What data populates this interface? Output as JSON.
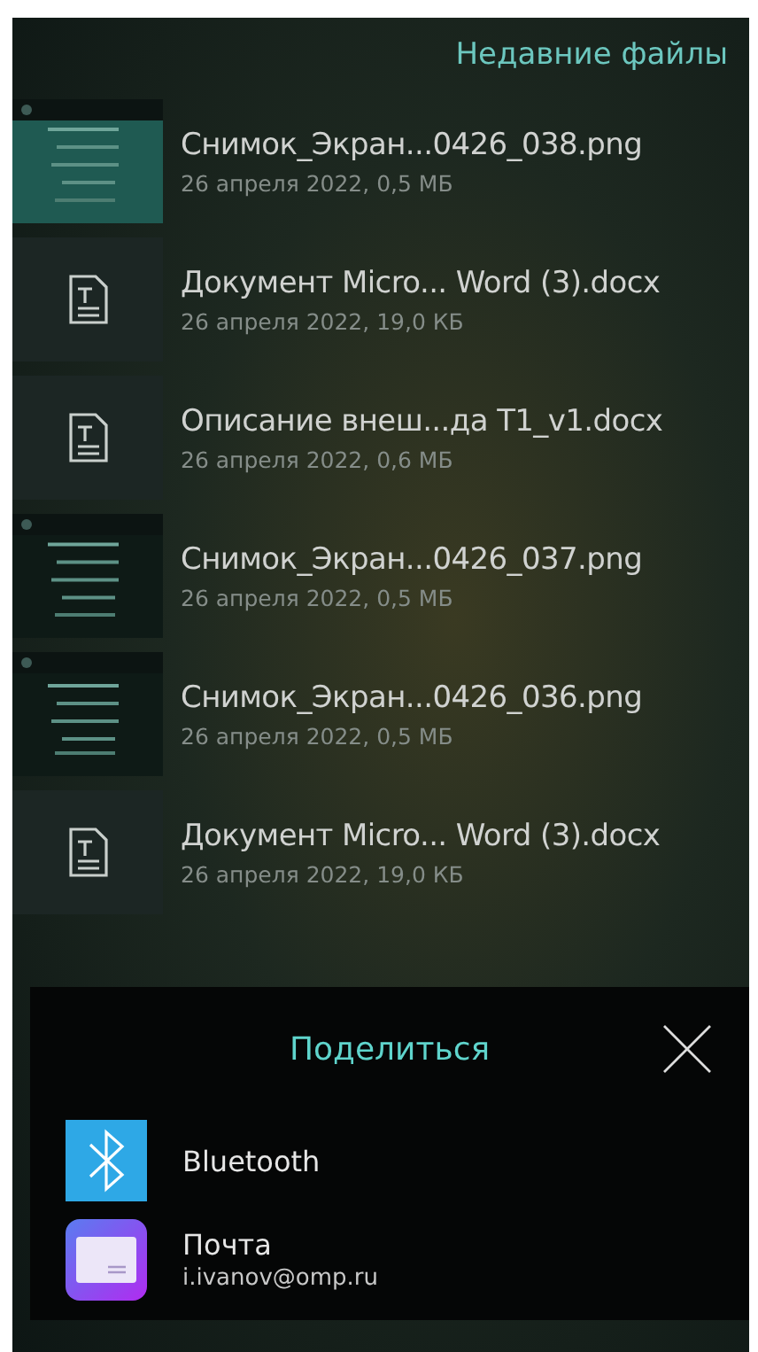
{
  "header": {
    "title": "Недавние файлы"
  },
  "files": [
    {
      "kind": "picture",
      "name": "Снимок_Экран...0426_038.png",
      "details": "26 апреля 2022, 0,5 МБ"
    },
    {
      "kind": "document",
      "name": "Документ Micro... Word (3).docx",
      "details": "26 апреля 2022, 19,0 КБ"
    },
    {
      "kind": "document",
      "name": "Описание внеш...да T1_v1.docx",
      "details": "26 апреля 2022, 0,6 МБ"
    },
    {
      "kind": "picture",
      "name": "Снимок_Экран...0426_037.png",
      "details": "26 апреля 2022, 0,5 МБ"
    },
    {
      "kind": "picture",
      "name": "Снимок_Экран...0426_036.png",
      "details": "26 апреля 2022, 0,5 МБ"
    },
    {
      "kind": "document",
      "name": "Документ Micro... Word (3).docx",
      "details": "26 апреля 2022, 19,0 КБ"
    }
  ],
  "share_sheet": {
    "title": "Поделиться",
    "targets": [
      {
        "kind": "bluetooth",
        "label": "Bluetooth"
      },
      {
        "kind": "mail",
        "label": "Почта",
        "account": "i.ivanov@omp.ru"
      }
    ]
  }
}
